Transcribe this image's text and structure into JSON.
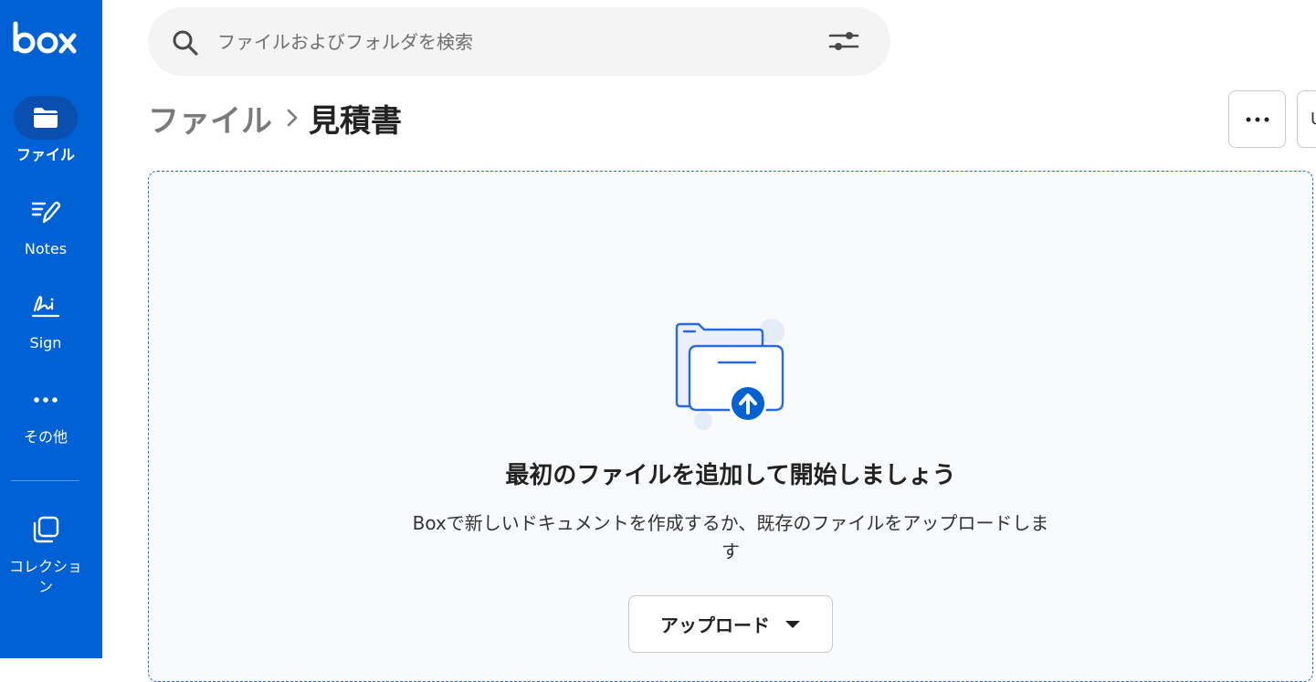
{
  "brand": {
    "logo_text": "box",
    "accent_color": "#0061d5"
  },
  "sidebar": {
    "items": [
      {
        "label": "ファイル",
        "icon": "folder-icon",
        "active": true
      },
      {
        "label": "Notes",
        "icon": "notes-icon",
        "active": false
      },
      {
        "label": "Sign",
        "icon": "sign-icon",
        "active": false
      },
      {
        "label": "その他",
        "icon": "more-horizontal-icon",
        "active": false
      },
      {
        "label": "コレクション",
        "icon": "collections-icon",
        "active": false
      }
    ]
  },
  "search": {
    "placeholder": "ファイルおよびフォルダを検索",
    "value": ""
  },
  "breadcrumb": {
    "root": "ファイル",
    "current": "見積書"
  },
  "toolbar": {
    "partial_button_label": "U"
  },
  "empty_state": {
    "title": "最初のファイルを追加して開始しましょう",
    "description": "Boxで新しいドキュメントを作成するか、既存のファイルをアップロードします",
    "upload_label": "アップロード"
  }
}
